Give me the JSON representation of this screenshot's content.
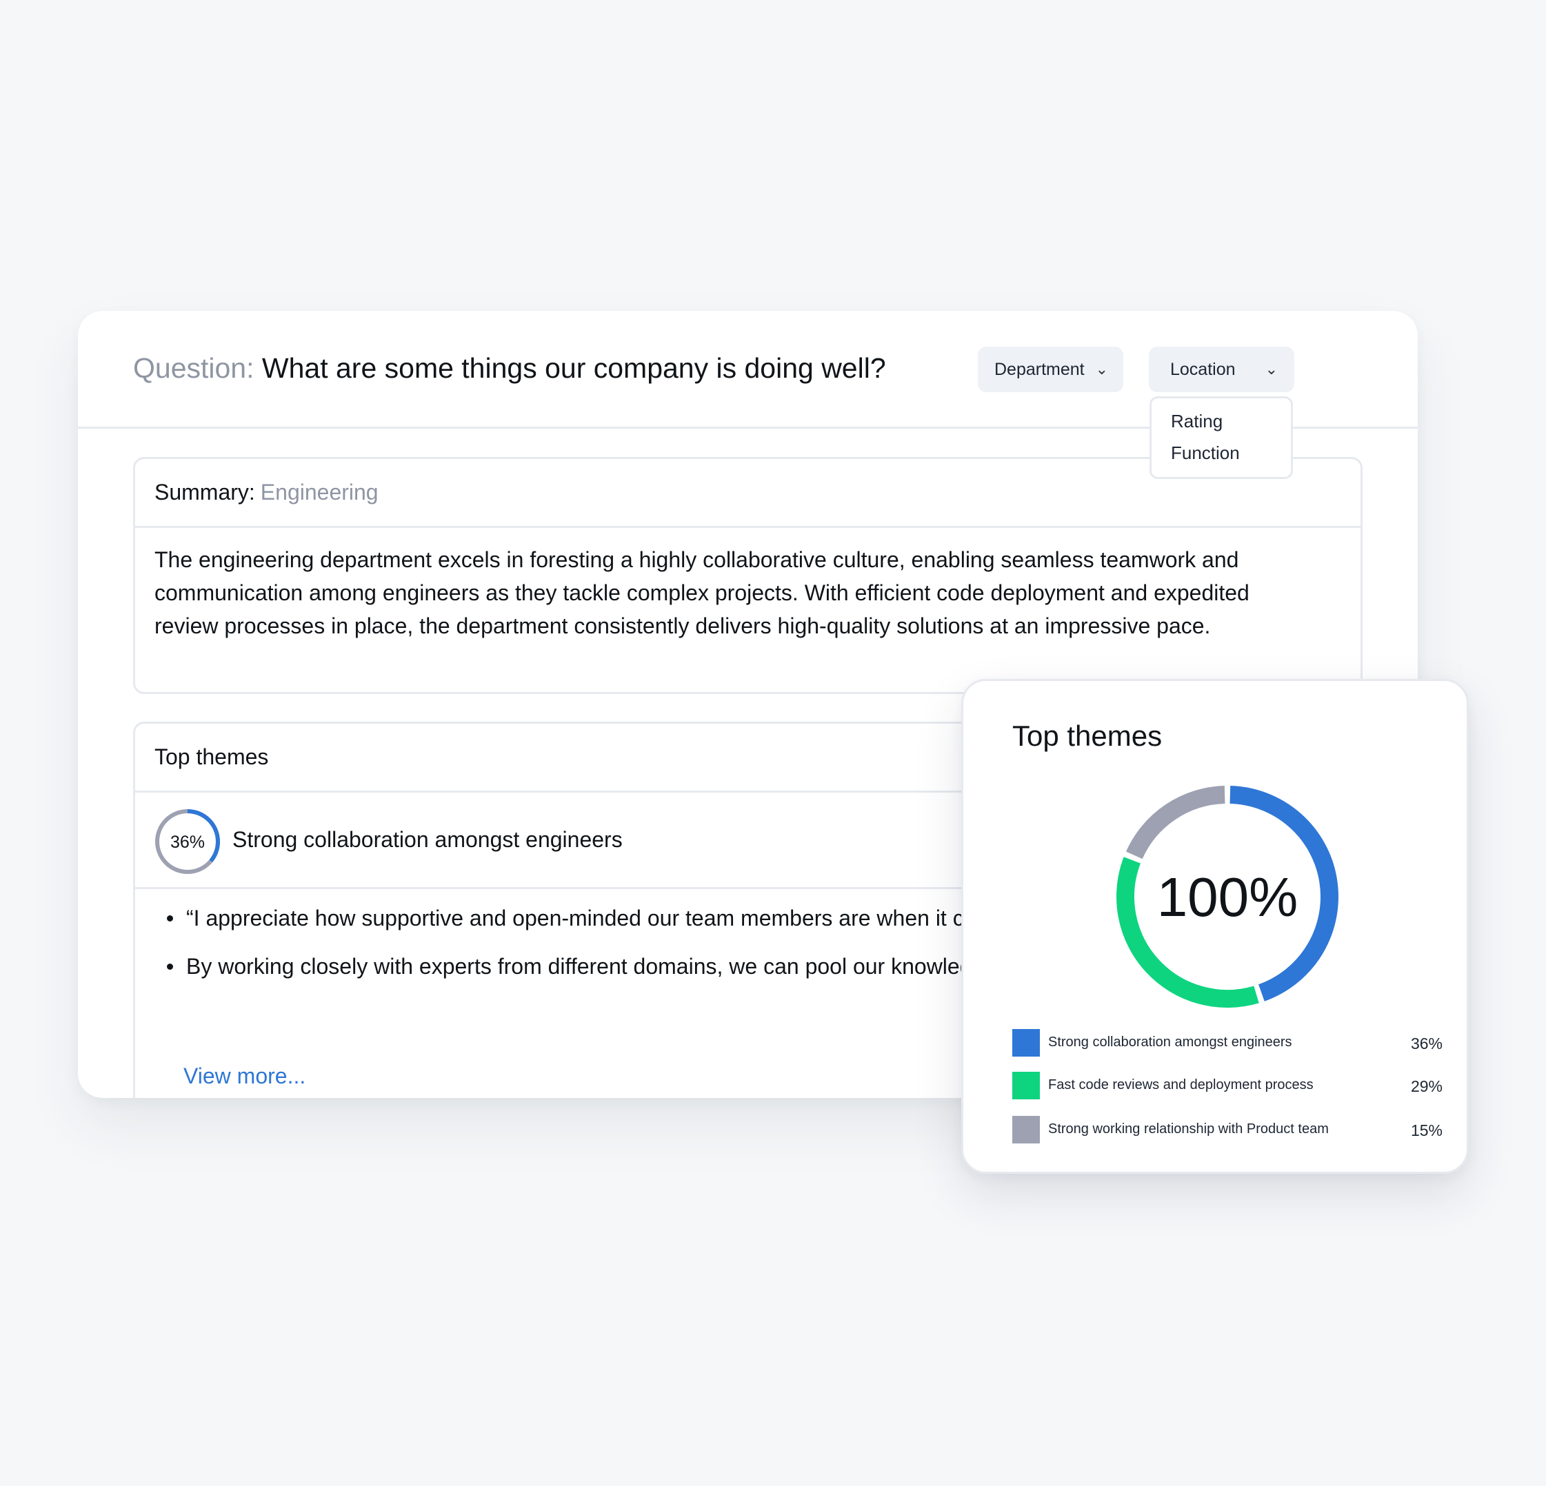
{
  "question": {
    "label": "Question:",
    "text": "What are some things our company is doing well?"
  },
  "filters": {
    "department": "Department",
    "location": "Location",
    "options": [
      "Rating",
      "Function"
    ]
  },
  "summary": {
    "label": "Summary:",
    "department": "Engineering",
    "text": "The engineering department excels in foresting a highly collaborative culture, enabling seamless teamwork and communication among engineers as they tackle complex projects. With efficient code deployment and expedited review processes in place, the department consistently delivers high-quality solutions at an impressive pace."
  },
  "top_themes": {
    "title": "Top themes",
    "theme": {
      "percent": "36%",
      "percent_value": 36,
      "name": "Strong collaboration amongst engineers"
    },
    "quotes": [
      "“I appreciate how supportive and open-minded our team members are when it comes to problem solving.”",
      "By working closely with experts from different domains, we can pool our knowledge and learn from one another.”"
    ],
    "view_more": "View more..."
  },
  "themes_card": {
    "title": "Top themes",
    "center_label": "100%"
  },
  "chart_data": {
    "type": "pie",
    "title": "Top themes",
    "center_label": "100%",
    "categories": [
      "Strong collaboration amongst engineers",
      "Fast code reviews and deployment process",
      "Strong working relationship with Product team"
    ],
    "values": [
      36,
      29,
      15
    ],
    "labels": [
      "36%",
      "29%",
      "15%"
    ],
    "colors": [
      "#2e77d6",
      "#0ed47f",
      "#9da1b2"
    ],
    "legend_position": "bottom"
  },
  "colors": {
    "accent_blue": "#2e77d6",
    "accent_green": "#0ed47f",
    "muted_gray": "#9da1b2",
    "link": "#2e77d6"
  }
}
